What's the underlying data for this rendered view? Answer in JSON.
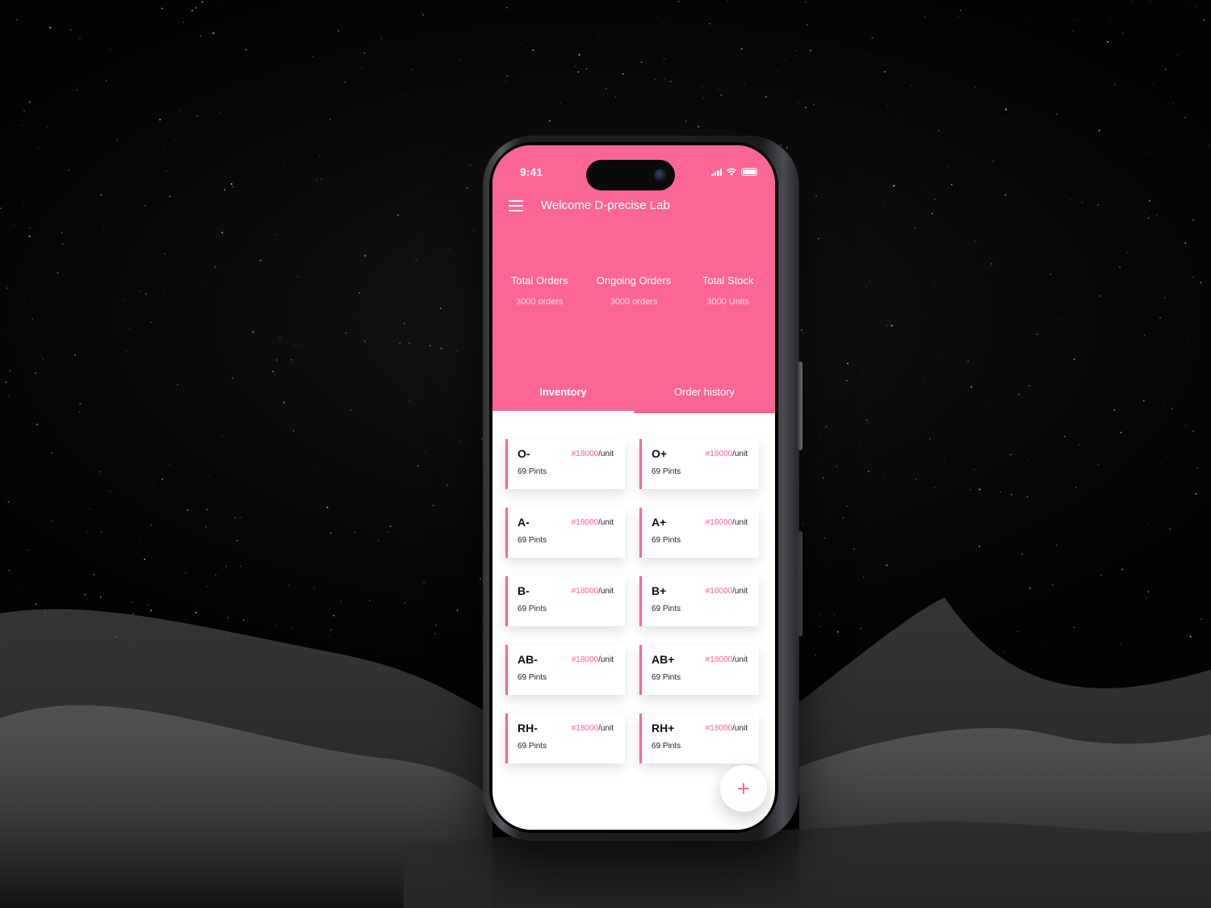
{
  "status_bar": {
    "time": "9:41",
    "icons": [
      "signal-icon",
      "wifi-icon",
      "battery-icon"
    ]
  },
  "header": {
    "welcome": "Welcome D-precise Lab",
    "menu_icon": "menu-icon"
  },
  "stats": [
    {
      "label": "Total Orders",
      "value": "3000 orders"
    },
    {
      "label": "Ongoing Orders",
      "value": "3000 orders"
    },
    {
      "label": "Total Stock",
      "value": "3000 Units"
    }
  ],
  "tabs": [
    {
      "label": "Inventory",
      "active": true
    },
    {
      "label": "Order history",
      "active": false
    }
  ],
  "inventory": [
    {
      "type": "O-",
      "price": "#18000",
      "unit": "/unit",
      "pints": "69 Pints"
    },
    {
      "type": "O+",
      "price": "#18000",
      "unit": "/unit",
      "pints": "69 Pints"
    },
    {
      "type": "A-",
      "price": "#18000",
      "unit": "/unit",
      "pints": "69 Pints"
    },
    {
      "type": "A+",
      "price": "#18000",
      "unit": "/unit",
      "pints": "69 Pints"
    },
    {
      "type": "B-",
      "price": "#18000",
      "unit": "/unit",
      "pints": "69 Pints"
    },
    {
      "type": "B+",
      "price": "#18000",
      "unit": "/unit",
      "pints": "69 Pints"
    },
    {
      "type": "AB-",
      "price": "#18000",
      "unit": "/unit",
      "pints": "69 Pints"
    },
    {
      "type": "AB+",
      "price": "#18000",
      "unit": "/unit",
      "pints": "69 Pints"
    },
    {
      "type": "RH-",
      "price": "#18000",
      "unit": "/unit",
      "pints": "69 Pints"
    },
    {
      "type": "RH+",
      "price": "#18000",
      "unit": "/unit",
      "pints": "69 Pints"
    }
  ],
  "fab": {
    "icon": "plus-icon"
  },
  "colors": {
    "accent": "#fb6694",
    "background": "#050505",
    "card": "#ffffff"
  }
}
